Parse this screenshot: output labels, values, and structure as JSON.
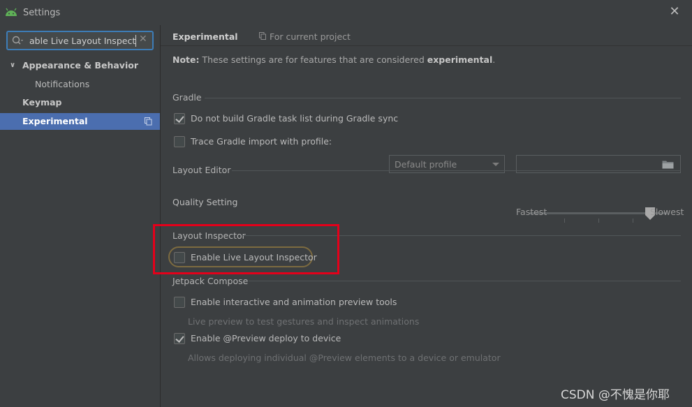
{
  "window": {
    "title": "Settings",
    "close_glyph": "✕",
    "app_icon": "android-icon"
  },
  "search": {
    "value": "able Live Layout Inspector",
    "icon": "search-icon",
    "clear_glyph": "✕"
  },
  "sidebar": {
    "items": [
      {
        "label": "Appearance & Behavior",
        "expanded": true
      },
      {
        "label": "Notifications"
      },
      {
        "label": "Keymap"
      },
      {
        "label": "Experimental",
        "selected": true
      }
    ]
  },
  "header": {
    "breadcrumb": "Experimental",
    "scope": "For current project"
  },
  "note": {
    "prefix": "Note:",
    "text": " These settings are for features that are considered ",
    "emphasis": "experimental",
    "suffix": "."
  },
  "gradle": {
    "section": "Gradle",
    "do_not_build": {
      "label": "Do not build Gradle task list during Gradle sync",
      "checked": true
    },
    "trace_import": {
      "label": "Trace Gradle import with profile:",
      "checked": false
    },
    "profile_dropdown": "Default profile"
  },
  "layout_editor": {
    "section": "Layout Editor",
    "quality_label": "Quality Setting",
    "slider_min_label": "Fastest",
    "slider_max_label": "Slowest",
    "slider_value_fraction": 0.88
  },
  "layout_inspector": {
    "section": "Layout Inspector",
    "enable_live": {
      "label": "Enable Live Layout Inspector",
      "checked": false
    }
  },
  "compose": {
    "section": "Jetpack Compose",
    "interactive_preview": {
      "label": "Enable interactive and animation preview tools",
      "checked": false,
      "hint": "Live preview to test gestures and inspect animations"
    },
    "preview_deploy": {
      "label": "Enable @Preview deploy to device",
      "checked": true,
      "hint": "Allows deploying individual @Preview elements to a device or emulator"
    }
  },
  "watermark": "CSDN @不愧是你耶",
  "colors": {
    "accent": "#4b6eaf",
    "focus": "#3d7db8",
    "highlight_box": "#e4001a",
    "background": "#3c3f41"
  }
}
